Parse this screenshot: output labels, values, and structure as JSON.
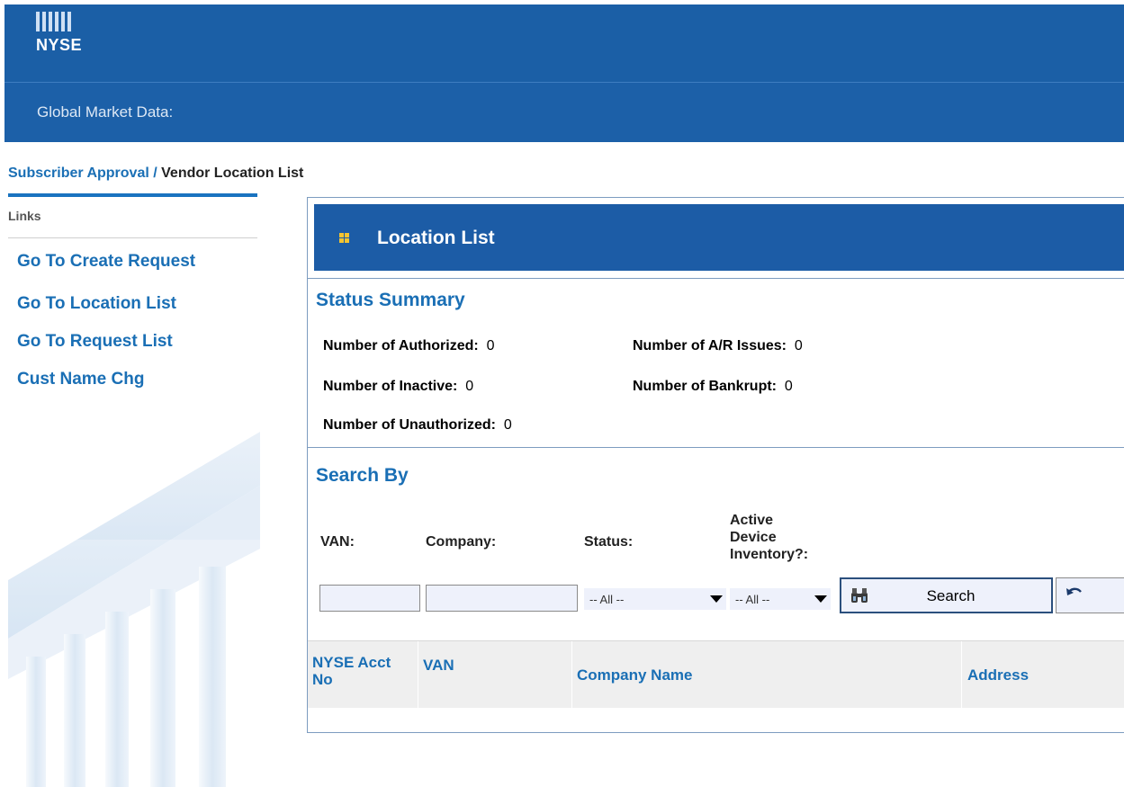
{
  "header": {
    "logo_text": "NYSE",
    "subtitle": "Global Market Data:"
  },
  "breadcrumb": {
    "parent": "Subscriber Approval",
    "separator": " / ",
    "current": "Vendor Location List"
  },
  "sidebar": {
    "title": "Links",
    "items": [
      {
        "label": "Go To Create Request"
      },
      {
        "label": "Go To Location List"
      },
      {
        "label": "Go To Request List"
      },
      {
        "label": "Cust Name Chg"
      }
    ]
  },
  "panel": {
    "title": "Location List"
  },
  "status_summary": {
    "title": "Status Summary",
    "authorized": {
      "label": "Number of Authorized:",
      "value": "0"
    },
    "ar_issues": {
      "label": "Number of A/R Issues:",
      "value": "0"
    },
    "inactive": {
      "label": "Number of Inactive:",
      "value": "0"
    },
    "bankrupt": {
      "label": "Number of Bankrupt:",
      "value": "0"
    },
    "unauthorized": {
      "label": "Number of Unauthorized:",
      "value": "0"
    }
  },
  "search": {
    "title": "Search By",
    "van_label": "VAN:",
    "company_label": "Company:",
    "status_label": "Status:",
    "active_label_1": "Active",
    "active_label_2": "Device",
    "active_label_3": "Inventory?:",
    "van_value": "",
    "company_value": "",
    "status_selected": "-- All --",
    "active_selected": "-- All --",
    "search_button": "Search"
  },
  "table": {
    "columns": [
      "NYSE Acct No",
      "VAN",
      "Company Name",
      "Address"
    ],
    "col_acct_1": "NYSE Acct",
    "col_acct_2": "No"
  },
  "colors": {
    "header_blue": "#1b5fa6",
    "link_blue": "#1a6fb5",
    "panel_blue": "#1c5ca6",
    "accent_gold": "#f4c431"
  }
}
